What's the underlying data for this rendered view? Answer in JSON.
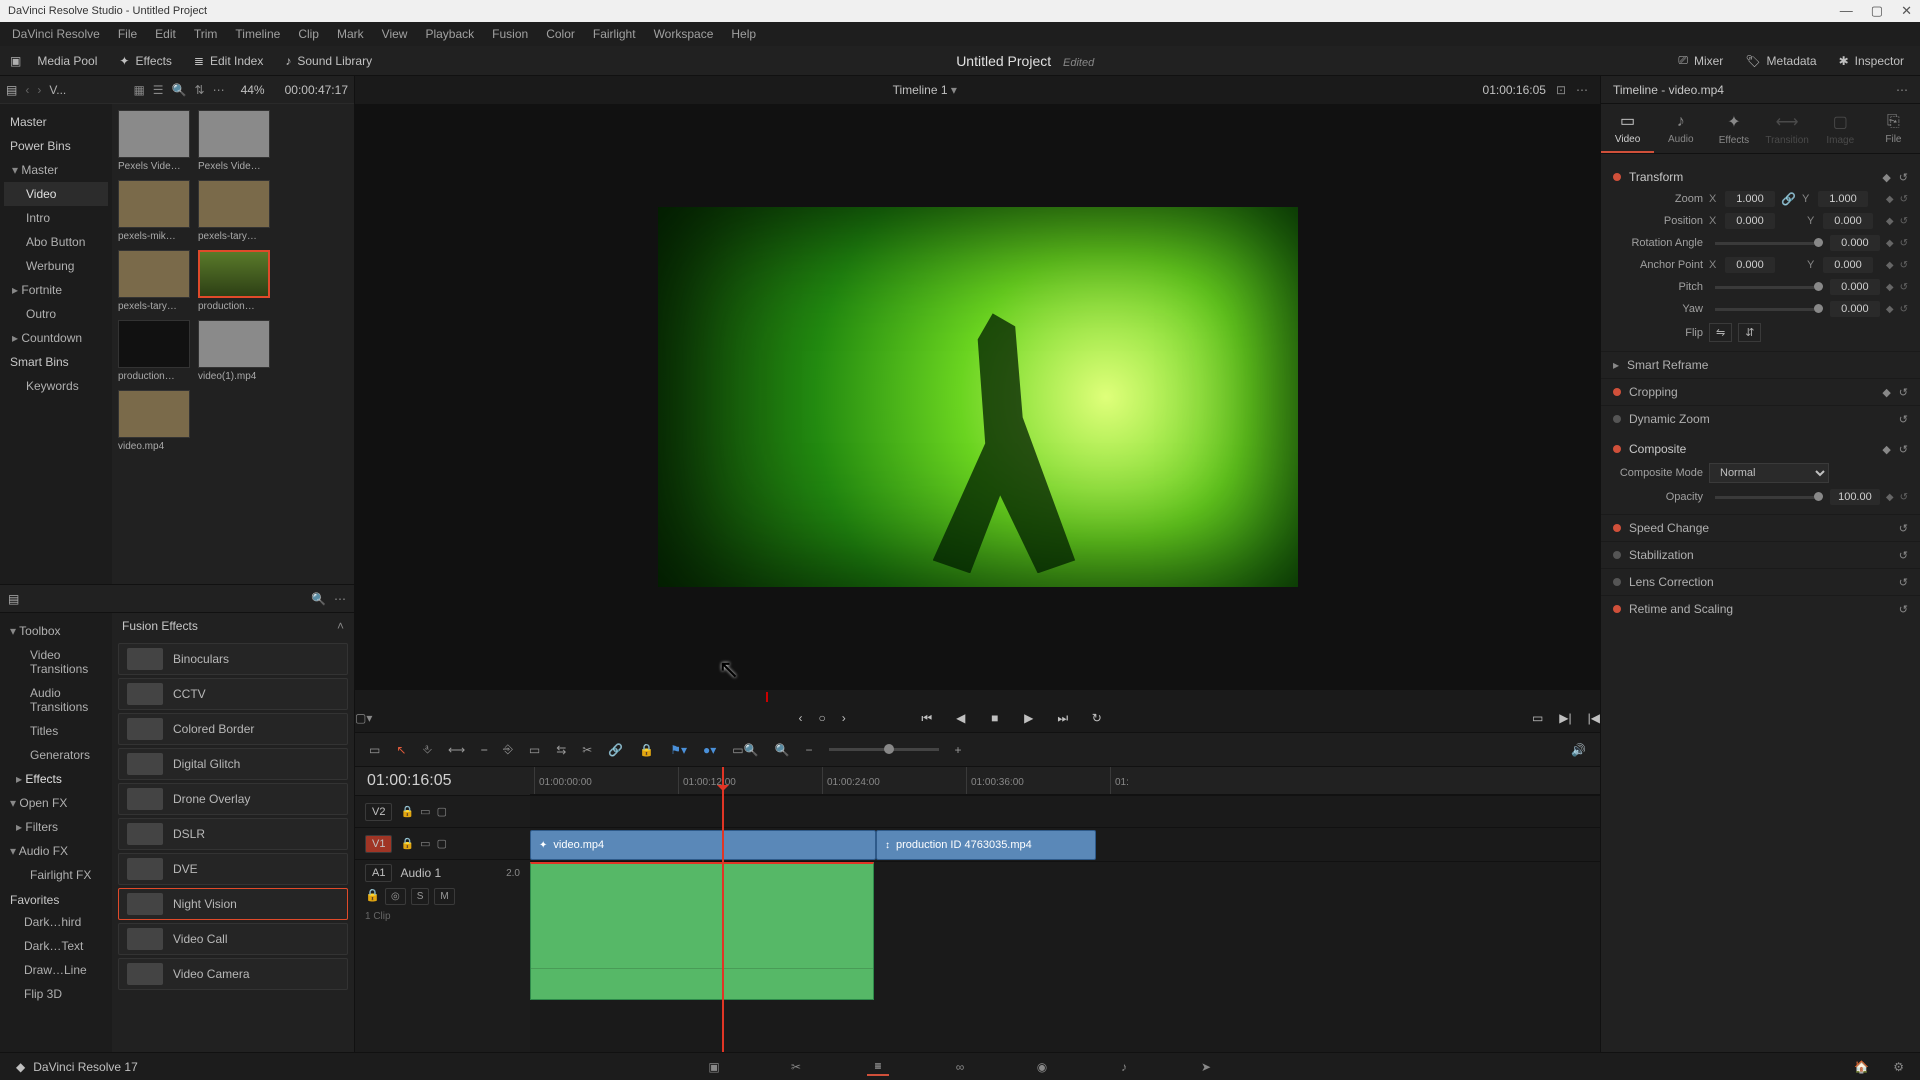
{
  "titlebar": {
    "title": "DaVinci Resolve Studio - Untitled Project"
  },
  "menubar": [
    "DaVinci Resolve",
    "File",
    "Edit",
    "Trim",
    "Timeline",
    "Clip",
    "Mark",
    "View",
    "Playback",
    "Fusion",
    "Color",
    "Fairlight",
    "Workspace",
    "Help"
  ],
  "topbar": {
    "media_pool": "Media Pool",
    "effects": "Effects",
    "edit_index": "Edit Index",
    "sound_library": "Sound Library",
    "mixer": "Mixer",
    "metadata": "Metadata",
    "inspector": "Inspector",
    "project_title": "Untitled Project",
    "edited": "Edited"
  },
  "browser": {
    "sort_mode": "V...",
    "zoom_pct": "44%",
    "tc": "00:00:47:17"
  },
  "bins": {
    "master": "Master",
    "power_bins": "Power Bins",
    "pb_items": [
      "Master",
      "Video",
      "Intro",
      "Abo Button",
      "Werbung",
      "Fortnite",
      "Outro",
      "Countdown"
    ],
    "smart_bins": "Smart Bins",
    "keywords": "Keywords"
  },
  "clips": [
    {
      "label": "Pexels Vide…",
      "cls": "pex"
    },
    {
      "label": "Pexels Vide…",
      "cls": "pex"
    },
    {
      "label": "pexels-mik…",
      "cls": "tary"
    },
    {
      "label": "pexels-tary…",
      "cls": "tary"
    },
    {
      "label": "pexels-tary…",
      "cls": "tary"
    },
    {
      "label": "production…",
      "cls": "prod",
      "sel": true
    },
    {
      "label": "production…",
      "cls": "dark"
    },
    {
      "label": "video(1).mp4",
      "cls": "pex"
    },
    {
      "label": "video.mp4",
      "cls": "tary"
    }
  ],
  "fx_tree": {
    "toolbox": "Toolbox",
    "items": [
      "Video Transitions",
      "Audio Transitions",
      "Titles",
      "Generators",
      "Effects"
    ],
    "openfx": "Open FX",
    "filters": "Filters",
    "audiofx": "Audio FX",
    "fairlight": "Fairlight FX",
    "favorites": "Favorites",
    "favs": [
      "Dark…hird",
      "Dark…Text",
      "Draw…Line",
      "Flip 3D"
    ]
  },
  "fx_list": {
    "header": "Fusion Effects",
    "items": [
      "Binoculars",
      "CCTV",
      "Colored Border",
      "Digital Glitch",
      "Drone Overlay",
      "DSLR",
      "DVE",
      "Night Vision",
      "Video Call",
      "Video Camera"
    ],
    "selected": "Night Vision"
  },
  "viewer": {
    "timeline_name": "Timeline 1",
    "tc": "01:00:16:05"
  },
  "timeline": {
    "tc": "01:00:16:05",
    "ruler": [
      "01:00:00:00",
      "01:00:12:00",
      "01:00:24:00",
      "01:00:36:00",
      "01:"
    ],
    "v2": "V2",
    "v1": "V1",
    "a1": "A1",
    "a1_name": "Audio 1",
    "a1_meter": "2.0",
    "a1_clipcount": "1 Clip",
    "clip1": "video.mp4",
    "clip2": "production ID 4763035.mp4",
    "btns": {
      "s": "S",
      "m": "M"
    }
  },
  "inspector": {
    "header": "Timeline - video.mp4",
    "tabs": [
      "Video",
      "Audio",
      "Effects",
      "Transition",
      "Image",
      "File"
    ],
    "transform": "Transform",
    "zoom_label": "Zoom",
    "zoom_x": "1.000",
    "zoom_y": "1.000",
    "pos_label": "Position",
    "pos_x": "0.000",
    "pos_y": "0.000",
    "rot_label": "Rotation Angle",
    "rot": "0.000",
    "anchor_label": "Anchor Point",
    "anchor_x": "0.000",
    "anchor_y": "0.000",
    "pitch_label": "Pitch",
    "pitch": "0.000",
    "yaw_label": "Yaw",
    "yaw": "0.000",
    "flip_label": "Flip",
    "smart_reframe": "Smart Reframe",
    "cropping": "Cropping",
    "dynamic_zoom": "Dynamic Zoom",
    "composite": "Composite",
    "composite_mode_label": "Composite Mode",
    "composite_mode": "Normal",
    "opacity_label": "Opacity",
    "opacity": "100.00",
    "speed_change": "Speed Change",
    "stabilization": "Stabilization",
    "lens_correction": "Lens Correction",
    "retime": "Retime and Scaling",
    "axis_x": "X",
    "axis_y": "Y"
  },
  "statusbar": {
    "app": "DaVinci Resolve 17"
  }
}
